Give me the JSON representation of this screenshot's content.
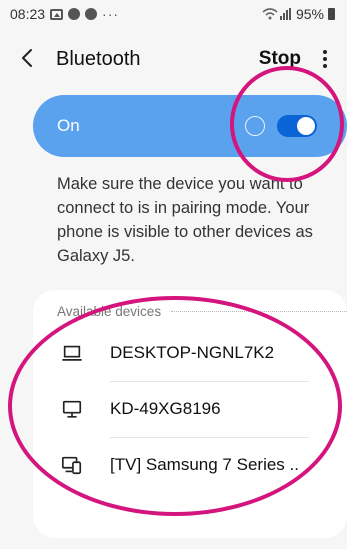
{
  "status_bar": {
    "time": "08:23",
    "dots": "···",
    "battery": "95%"
  },
  "app_bar": {
    "title": "Bluetooth",
    "stop_label": "Stop"
  },
  "bluetooth_toggle": {
    "label": "On",
    "state": true
  },
  "description": "Make sure the device you want to connect to is in pairing mode. Your phone is visible to other devices as Galaxy J5.",
  "available_devices": {
    "header": "Available devices",
    "items": [
      {
        "name": "DESKTOP-NGNL7K2",
        "icon": "laptop-icon"
      },
      {
        "name": "KD-49XG8196",
        "icon": "monitor-icon"
      },
      {
        "name": "[TV] Samsung 7 Series ..",
        "icon": "tv-phone-icon"
      }
    ]
  },
  "colors": {
    "accent": "#5aa2ee",
    "toggle": "#0a64d6",
    "annotation": "#d4157d"
  }
}
